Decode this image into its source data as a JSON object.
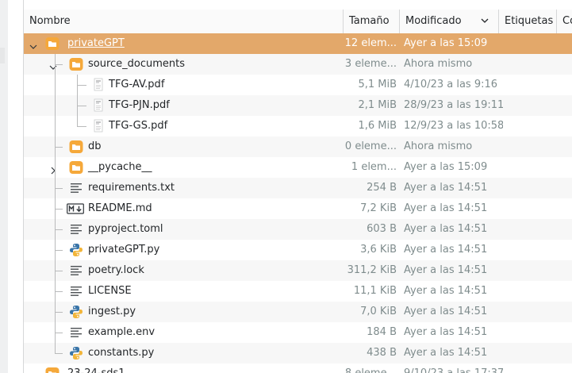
{
  "columns": {
    "name": "Nombre",
    "size": "Tamaño",
    "modified": "Modificado",
    "tags": "Etiquetas",
    "extra": "Co"
  },
  "rows": [
    {
      "name": "privateGPT",
      "size": "12 elem...",
      "modified": "Ayer a las 15:09",
      "icon": "folder-icon",
      "expander": "chevron-down-icon"
    },
    {
      "name": "source_documents",
      "size": "3 eleme...",
      "modified": "Ahora mismo",
      "icon": "folder-icon",
      "expander": "chevron-down-icon"
    },
    {
      "name": "TFG-AV.pdf",
      "size": "5,1 MiB",
      "modified": "4/10/23 a las 9:16",
      "icon": "pdf-thumbnail-icon"
    },
    {
      "name": "TFG-PJN.pdf",
      "size": "2,1 MiB",
      "modified": "28/9/23 a las 19:11",
      "icon": "pdf-thumbnail-icon"
    },
    {
      "name": "TFG-GS.pdf",
      "size": "1,6 MiB",
      "modified": "12/9/23 a las 10:58",
      "icon": "pdf-thumbnail-icon"
    },
    {
      "name": "db",
      "size": "0 eleme...",
      "modified": "Ahora mismo",
      "icon": "folder-icon"
    },
    {
      "name": "__pycache__",
      "size": "1 elem...",
      "modified": "Ayer a las 15:09",
      "icon": "folder-icon",
      "expander": "chevron-right-icon"
    },
    {
      "name": "requirements.txt",
      "size": "254 B",
      "modified": "Ayer a las 14:51",
      "icon": "text-file-icon"
    },
    {
      "name": "README.md",
      "size": "7,2 KiB",
      "modified": "Ayer a las 14:51",
      "icon": "markdown-file-icon"
    },
    {
      "name": "pyproject.toml",
      "size": "603 B",
      "modified": "Ayer a las 14:51",
      "icon": "text-file-icon"
    },
    {
      "name": "privateGPT.py",
      "size": "3,6 KiB",
      "modified": "Ayer a las 14:51",
      "icon": "python-file-icon"
    },
    {
      "name": "poetry.lock",
      "size": "311,2 KiB",
      "modified": "Ayer a las 14:51",
      "icon": "text-file-icon"
    },
    {
      "name": "LICENSE",
      "size": "11,1 KiB",
      "modified": "Ayer a las 14:51",
      "icon": "text-file-icon"
    },
    {
      "name": "ingest.py",
      "size": "7,0 KiB",
      "modified": "Ayer a las 14:51",
      "icon": "python-file-icon"
    },
    {
      "name": "example.env",
      "size": "184 B",
      "modified": "Ayer a las 14:51",
      "icon": "text-file-icon"
    },
    {
      "name": "constants.py",
      "size": "438 B",
      "modified": "Ayer a las 14:51",
      "icon": "python-file-icon"
    },
    {
      "name": "23-24-sds1",
      "size": "8 eleme...",
      "modified": "9/10/23 a las 17:37",
      "icon": "folder-icon",
      "expander": "chevron-right-icon"
    }
  ],
  "colors": {
    "selection": "#e3a86a",
    "folder": "#f5a83a",
    "python_blue": "#3a75a8",
    "python_yellow": "#f2b53a",
    "secondary_text": "#7f8c8d"
  }
}
